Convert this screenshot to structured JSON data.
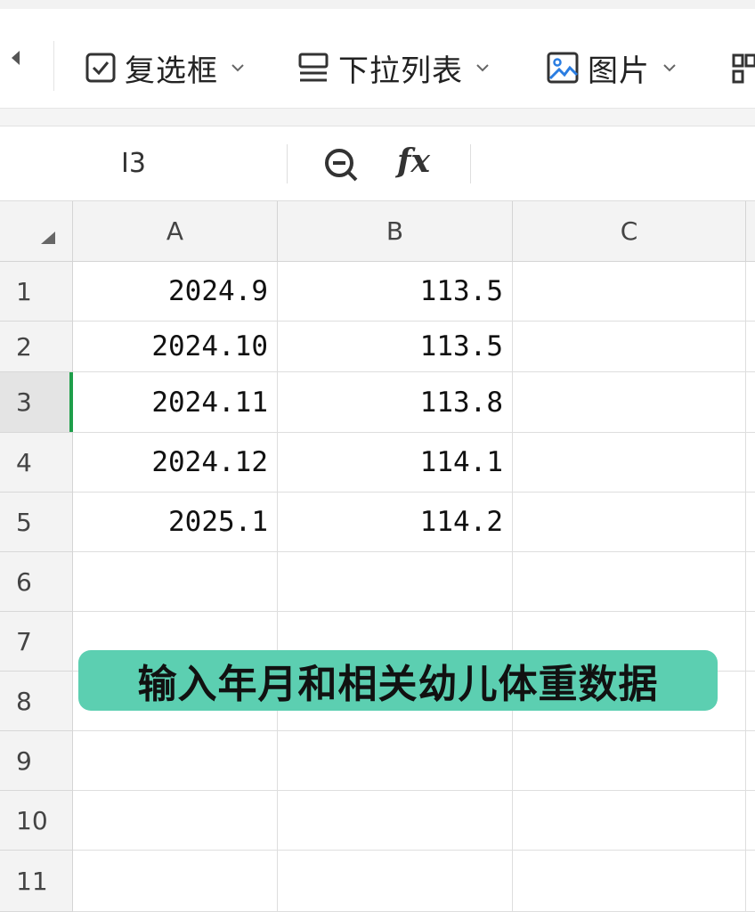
{
  "toolbar": {
    "items": [
      {
        "label": "复选框",
        "icon": "checkbox-icon"
      },
      {
        "label": "下拉列表",
        "icon": "dropdown-list-icon"
      },
      {
        "label": "图片",
        "icon": "image-icon"
      }
    ]
  },
  "formula_bar": {
    "cell_ref": "I3",
    "fx_label": "fx"
  },
  "grid": {
    "columns": [
      "A",
      "B",
      "C"
    ],
    "rows": [
      "1",
      "2",
      "3",
      "4",
      "5",
      "6",
      "7",
      "8",
      "9",
      "10",
      "11"
    ],
    "active_row": "3",
    "cells": [
      {
        "a": "2024.9",
        "b": "113.5"
      },
      {
        "a": "2024.10",
        "b": "113.5"
      },
      {
        "a": "2024.11",
        "b": "113.8"
      },
      {
        "a": "2024.12",
        "b": "114.1"
      },
      {
        "a": "2025.1",
        "b": "114.2"
      }
    ]
  },
  "caption": "输入年月和相关幼儿体重数据",
  "colors": {
    "caption_bg": "#5ccfb1",
    "active_row_indicator": "#1e9e4a"
  }
}
